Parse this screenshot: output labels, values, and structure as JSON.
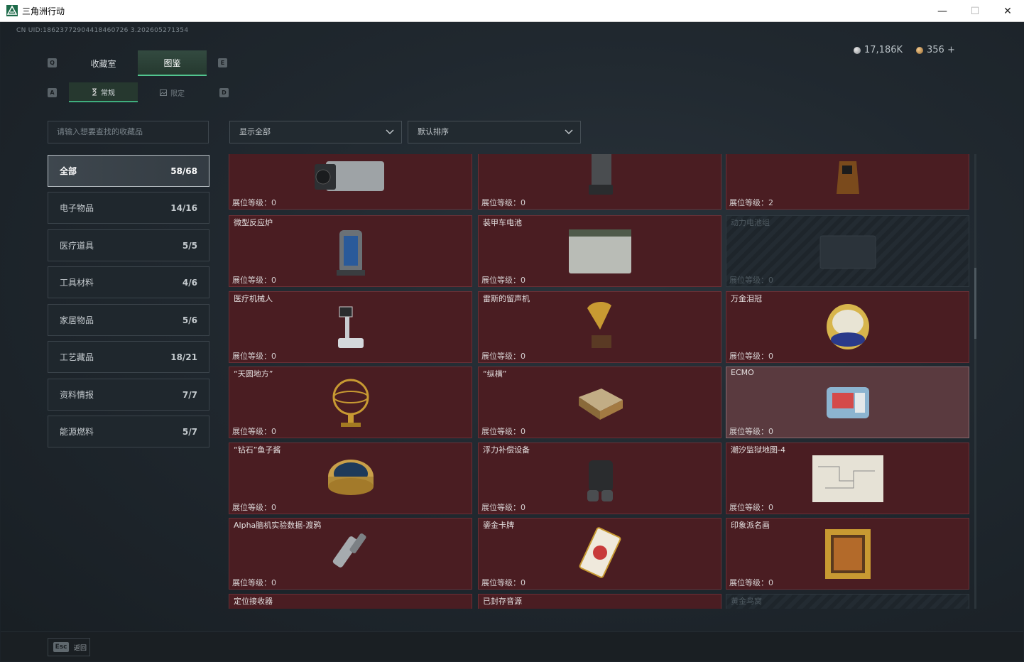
{
  "window": {
    "title": "三角洲行动",
    "minimize": "—",
    "maximize": "☐",
    "close": "✕"
  },
  "uid": "CN UID:18623772904418460726 3.202605271354",
  "currency": {
    "silver": "17,186K",
    "gold": "356 +"
  },
  "tabs": {
    "key_left": "Q",
    "key_right": "E",
    "items": [
      {
        "label": "收藏室"
      },
      {
        "label": "图鉴"
      }
    ]
  },
  "subtabs": {
    "key_left": "A",
    "key_right": "D",
    "items": [
      {
        "label": "常规"
      },
      {
        "label": "限定"
      }
    ]
  },
  "search": {
    "placeholder": "请输入想要查找的收藏品"
  },
  "filters": {
    "show": "显示全部",
    "sort": "默认排序"
  },
  "categories": [
    {
      "label": "全部",
      "count": "58/68"
    },
    {
      "label": "电子物品",
      "count": "14/16"
    },
    {
      "label": "医疗道具",
      "count": "5/5"
    },
    {
      "label": "工具材料",
      "count": "4/6"
    },
    {
      "label": "家居物品",
      "count": "5/6"
    },
    {
      "label": "工艺藏品",
      "count": "18/21"
    },
    {
      "label": "资料情报",
      "count": "7/7"
    },
    {
      "label": "能源燃料",
      "count": "5/7"
    }
  ],
  "level_prefix": "展位等级：",
  "items": [
    {
      "name": "",
      "level": "展位等级：0"
    },
    {
      "name": "",
      "level": "展位等级：0"
    },
    {
      "name": "",
      "level": "展位等级：2"
    },
    {
      "name": "微型反应炉",
      "level": "展位等级：0"
    },
    {
      "name": "装甲车电池",
      "level": "展位等级：0"
    },
    {
      "name": "动力电池组",
      "level": "展位等级：0"
    },
    {
      "name": "医疗机械人",
      "level": "展位等级：0"
    },
    {
      "name": "雷斯的留声机",
      "level": "展位等级：0"
    },
    {
      "name": "万金泪冠",
      "level": "展位等级：0"
    },
    {
      "name": "“天圆地方”",
      "level": "展位等级：0"
    },
    {
      "name": "“纵横”",
      "level": "展位等级：0"
    },
    {
      "name": "ECMO",
      "level": "展位等级：0"
    },
    {
      "name": "“钻石”鱼子酱",
      "level": "展位等级：0"
    },
    {
      "name": "浮力补偿设备",
      "level": "展位等级：0"
    },
    {
      "name": "潮汐监狱地图-4",
      "level": "展位等级：0"
    },
    {
      "name": "Alpha脑机实验数据-渡鸦",
      "level": "展位等级：0"
    },
    {
      "name": "鎏金卡牌",
      "level": "展位等级：0"
    },
    {
      "name": "印象派名画",
      "level": "展位等级：0"
    },
    {
      "name": "定位接收器",
      "level": ""
    },
    {
      "name": "已封存音源",
      "level": ""
    },
    {
      "name": "黄金鸟窝",
      "level": ""
    }
  ],
  "footer": {
    "esc": "Esc",
    "back": "返回"
  },
  "colors": {
    "accent_green": "#52c58f",
    "card_owned": "#4a1d22",
    "card_locked": "#232b32"
  }
}
